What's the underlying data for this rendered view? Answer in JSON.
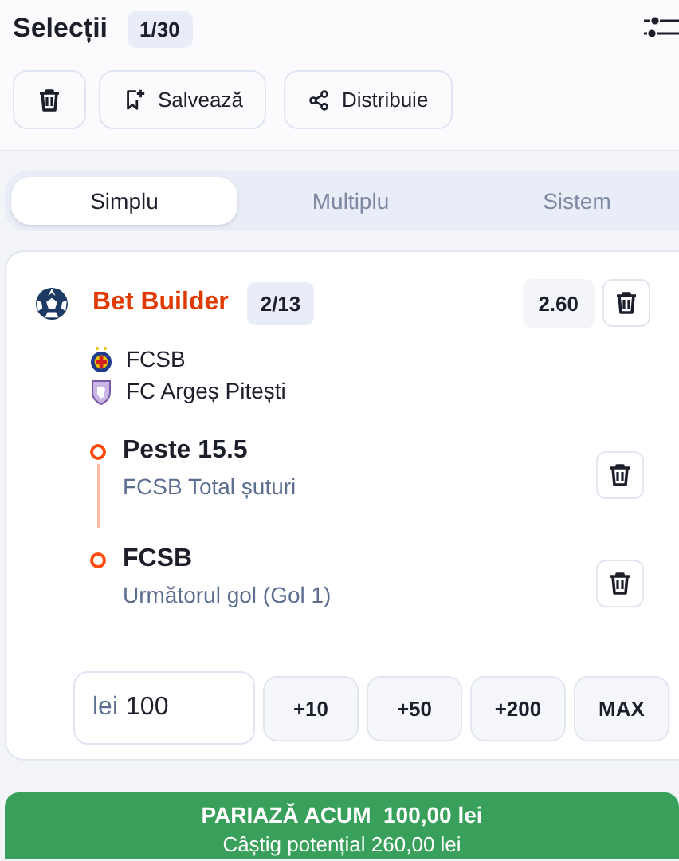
{
  "header": {
    "title": "Selecții",
    "count": "1/30"
  },
  "actions": [
    {
      "kind": "delete"
    },
    {
      "kind": "save",
      "label": "Salvează"
    },
    {
      "kind": "share",
      "label": "Distribuie"
    }
  ],
  "tabs": [
    {
      "label": "Simplu",
      "selected": true
    },
    {
      "label": "Multiplu",
      "selected": false
    },
    {
      "label": "Sistem",
      "selected": false
    }
  ],
  "bet": {
    "title": "Bet Builder",
    "count": "2/13",
    "odds": "2.60",
    "teams": [
      {
        "name": "FCSB",
        "kind": "home"
      },
      {
        "name": "FC Argeș Pitești",
        "kind": "away"
      }
    ],
    "selections": [
      {
        "pick": "Peste 15.5",
        "market": "FCSB Total șuturi"
      },
      {
        "pick": "FCSB",
        "market": "Următorul gol (Gol 1)"
      }
    ],
    "stake": {
      "currency": "lei",
      "value": "100"
    },
    "quick_amounts": [
      "+10",
      "+50",
      "+200",
      "MAX"
    ]
  },
  "place_bet": {
    "label": "PARIAZĂ ACUM",
    "amount": "100,00 lei",
    "potential_win": "Câștig potențial 260,00 lei"
  }
}
